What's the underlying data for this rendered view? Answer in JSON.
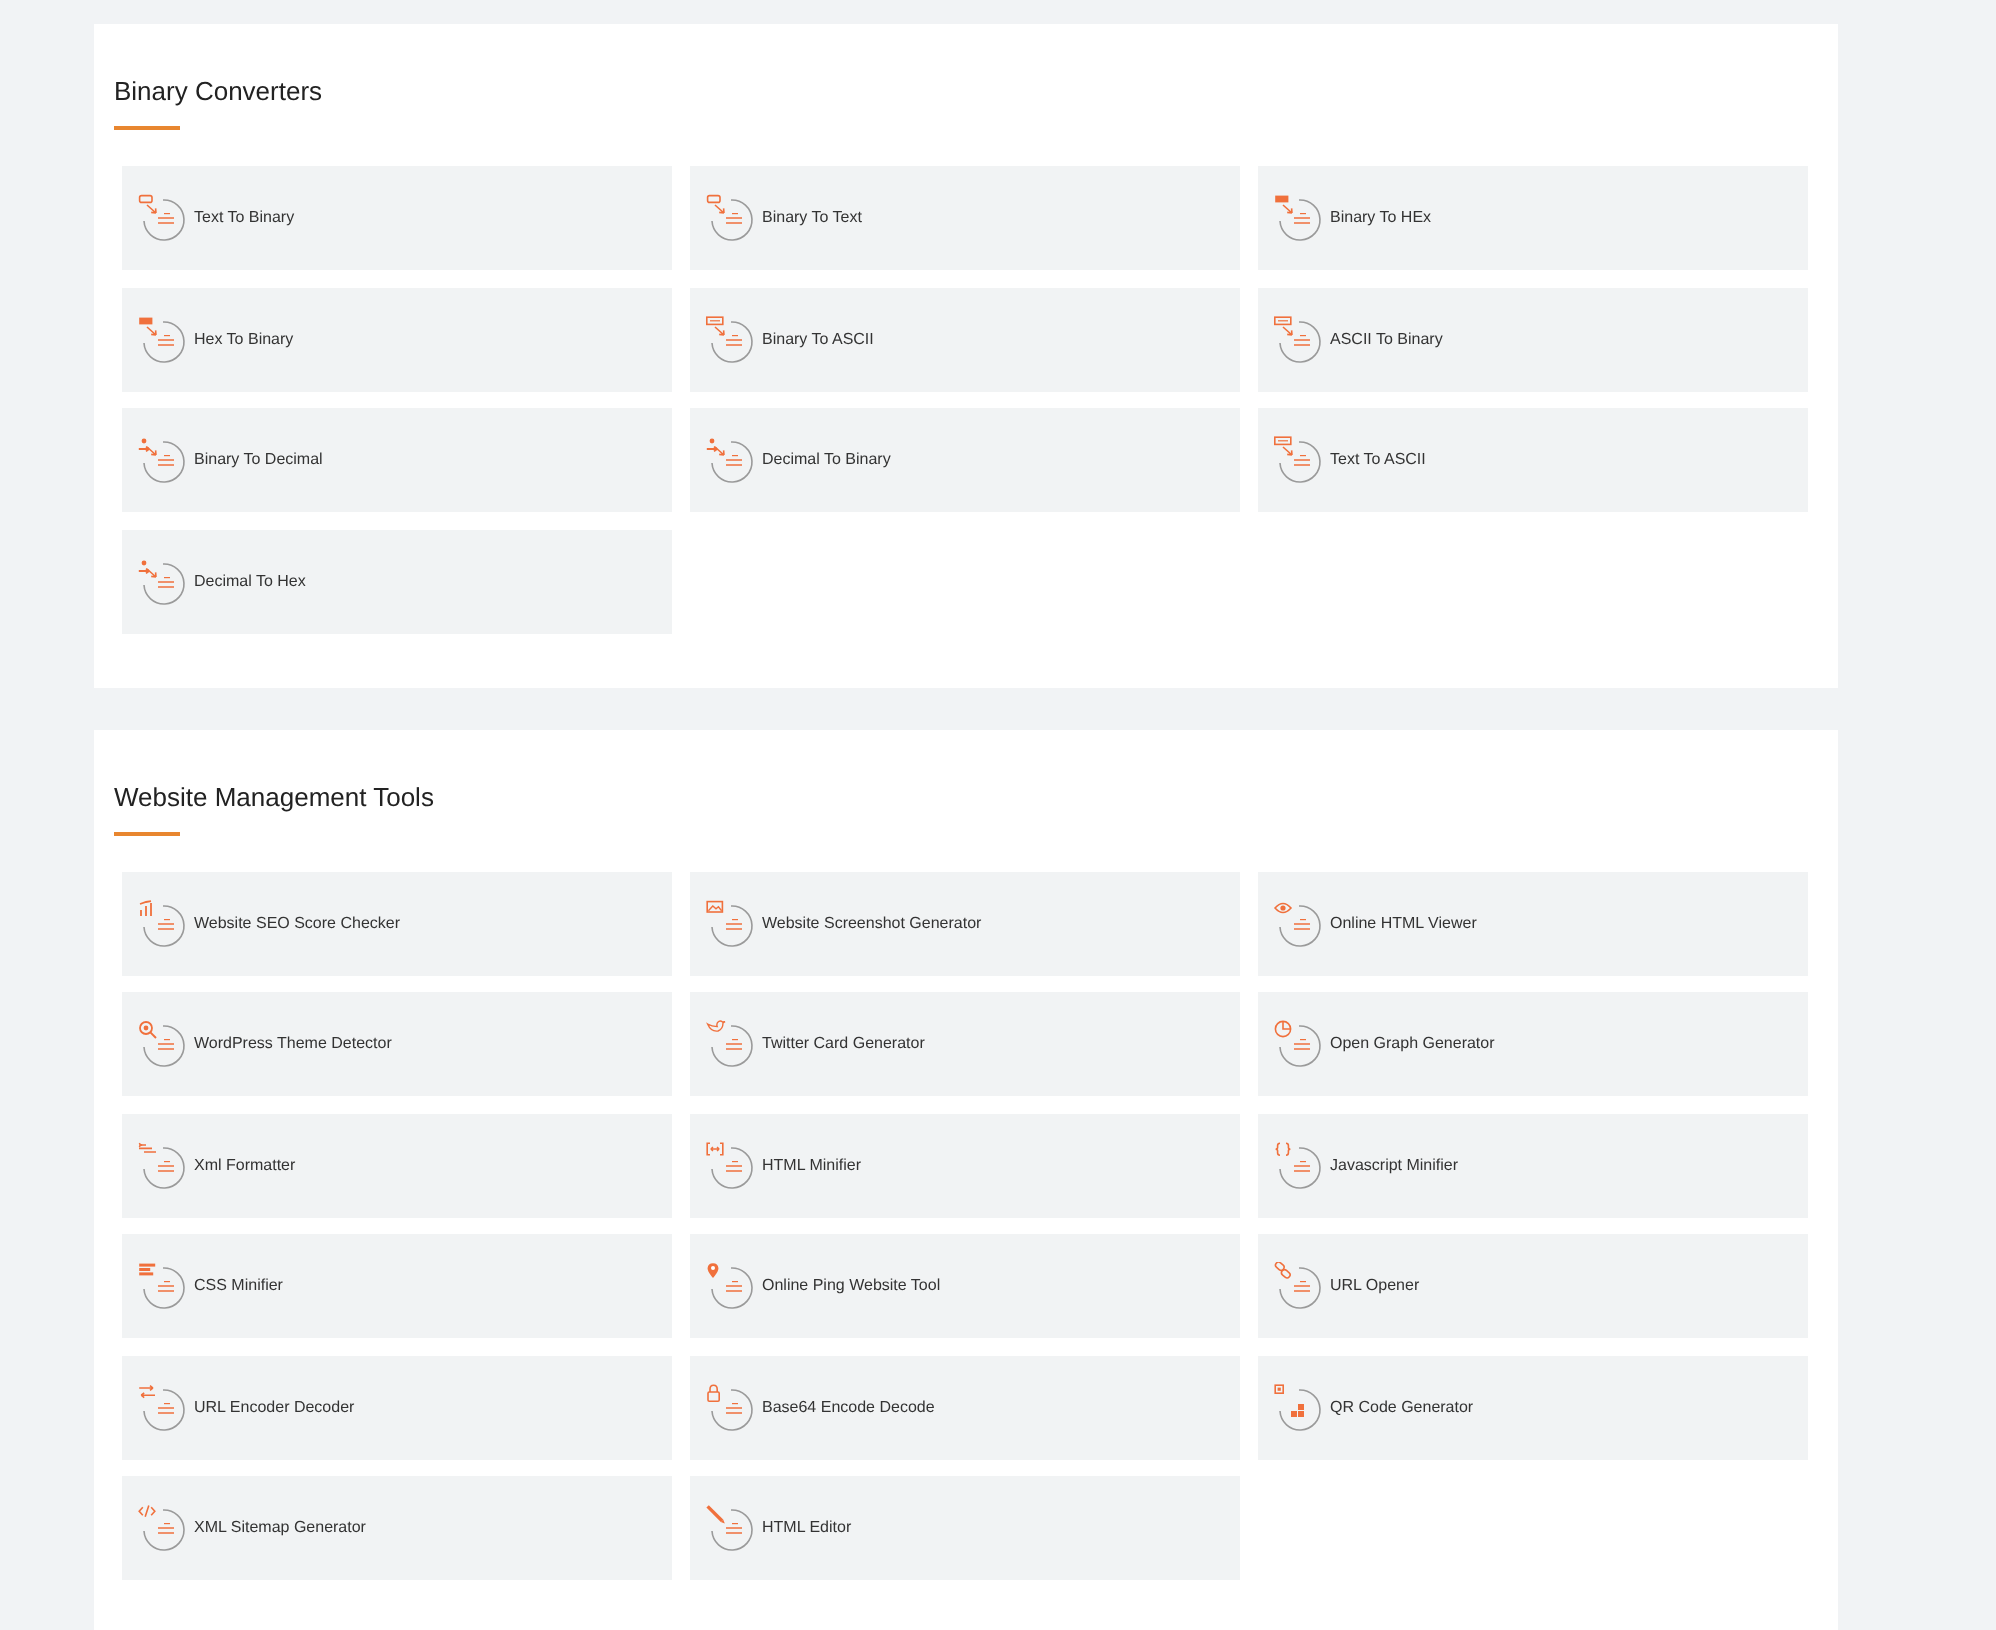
{
  "sections": [
    {
      "title": "Binary Converters",
      "tools": [
        {
          "label": "Text To Binary",
          "kind": "binary"
        },
        {
          "label": "Binary To Text",
          "kind": "binary"
        },
        {
          "label": "Binary To HEx",
          "kind": "hex"
        },
        {
          "label": "Hex To Binary",
          "kind": "hex"
        },
        {
          "label": "Binary To ASCII",
          "kind": "ascii"
        },
        {
          "label": "ASCII To Binary",
          "kind": "ascii"
        },
        {
          "label": "Binary To Decimal",
          "kind": "decimal"
        },
        {
          "label": "Decimal To Binary",
          "kind": "decimal"
        },
        {
          "label": "Text To ASCII",
          "kind": "ascii"
        },
        {
          "label": "Decimal To Hex",
          "kind": "decimal"
        }
      ]
    },
    {
      "title": "Website Management Tools",
      "tools": [
        {
          "label": "Website SEO Score Checker",
          "kind": "chart"
        },
        {
          "label": "Website Screenshot Generator",
          "kind": "image"
        },
        {
          "label": "Online HTML Viewer",
          "kind": "eye"
        },
        {
          "label": "WordPress Theme Detector",
          "kind": "search"
        },
        {
          "label": "Twitter Card Generator",
          "kind": "bird"
        },
        {
          "label": "Open Graph Generator",
          "kind": "pie"
        },
        {
          "label": "Xml Formatter",
          "kind": "xml"
        },
        {
          "label": "HTML Minifier",
          "kind": "brackets"
        },
        {
          "label": "Javascript Minifier",
          "kind": "js"
        },
        {
          "label": "CSS Minifier",
          "kind": "css"
        },
        {
          "label": "Online Ping Website Tool",
          "kind": "pin"
        },
        {
          "label": "URL Opener",
          "kind": "link"
        },
        {
          "label": "URL Encoder Decoder",
          "kind": "swap"
        },
        {
          "label": "Base64 Encode Decode",
          "kind": "lock"
        },
        {
          "label": "QR Code Generator",
          "kind": "qr"
        },
        {
          "label": "XML Sitemap Generator",
          "kind": "code"
        },
        {
          "label": "HTML Editor",
          "kind": "pencil"
        }
      ]
    }
  ]
}
